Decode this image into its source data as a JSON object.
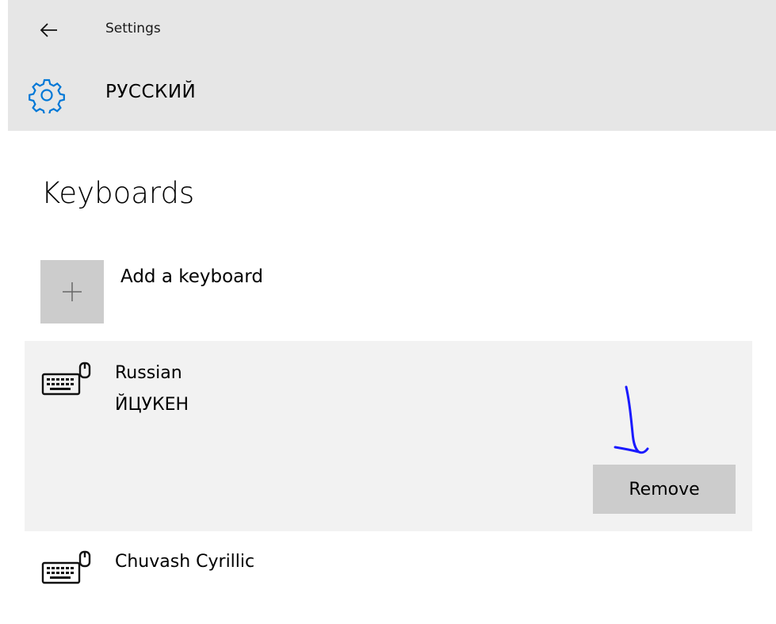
{
  "header": {
    "app_title": "Settings",
    "page_title": "РУССКИЙ"
  },
  "section": {
    "title": "Keyboards"
  },
  "add_keyboard": {
    "label": "Add a keyboard"
  },
  "keyboards": [
    {
      "name": "Russian",
      "layout": "ЙЦУКЕН",
      "selected": true,
      "remove_label": "Remove"
    },
    {
      "name": "Chuvash Cyrillic",
      "selected": false
    }
  ],
  "icons": {
    "back": "back-arrow-icon",
    "settings": "gear-icon",
    "add": "plus-icon",
    "keyboard": "keyboard-icon"
  },
  "colors": {
    "header_bg": "#e6e6e6",
    "accent": "#0078d7",
    "tile_bg": "#cccccc",
    "selected_bg": "#f2f2f2",
    "annotation": "#1a1aff"
  }
}
